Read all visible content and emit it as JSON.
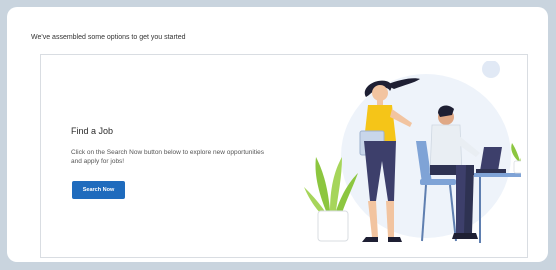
{
  "header": {
    "intro_text": "We've assembled some options to get you started"
  },
  "card": {
    "title": "Find a Job",
    "description": "Click on the Search Now button below to explore new opportunities and apply for jobs!",
    "search_button_label": "Search Now"
  },
  "colors": {
    "page_background": "#c9d4de",
    "button": "#1f6bbd",
    "woman_top": "#f5c518",
    "woman_pants": "#3d3f6b",
    "man_shirt": "#e9eef3",
    "plant": "#8cc63f",
    "desk": "#7fa3d6"
  },
  "illustration": {
    "icon": "job-search-illustration"
  }
}
